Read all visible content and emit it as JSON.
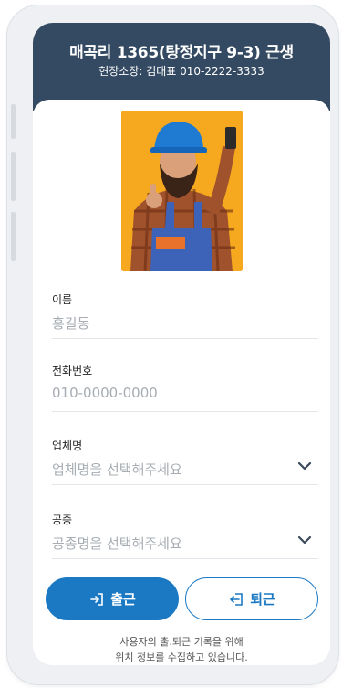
{
  "header": {
    "title": "매곡리 1365(탕정지구 9-3) 근생",
    "manager": "현장소장: 김대표 010-2222-3333"
  },
  "profile": {
    "photo_icon": "worker-photo"
  },
  "form": {
    "name": {
      "label": "이름",
      "value": "홍길동"
    },
    "phone": {
      "label": "전화번호",
      "placeholder": "010-0000-0000"
    },
    "company": {
      "label": "업체명",
      "placeholder": "업체명을 선택해주세요"
    },
    "trade": {
      "label": "공종",
      "placeholder": "공종명을 선택해주세요"
    }
  },
  "actions": {
    "checkin_label": "출근",
    "checkout_label": "퇴근"
  },
  "notice": {
    "line1": "사용자의 출.퇴근 기록을 위해",
    "line2": "위치 정보를 수집하고 있습니다."
  },
  "colors": {
    "header_bg": "#344a62",
    "accent": "#1b79c4",
    "photo_bg": "#f6a81e"
  }
}
